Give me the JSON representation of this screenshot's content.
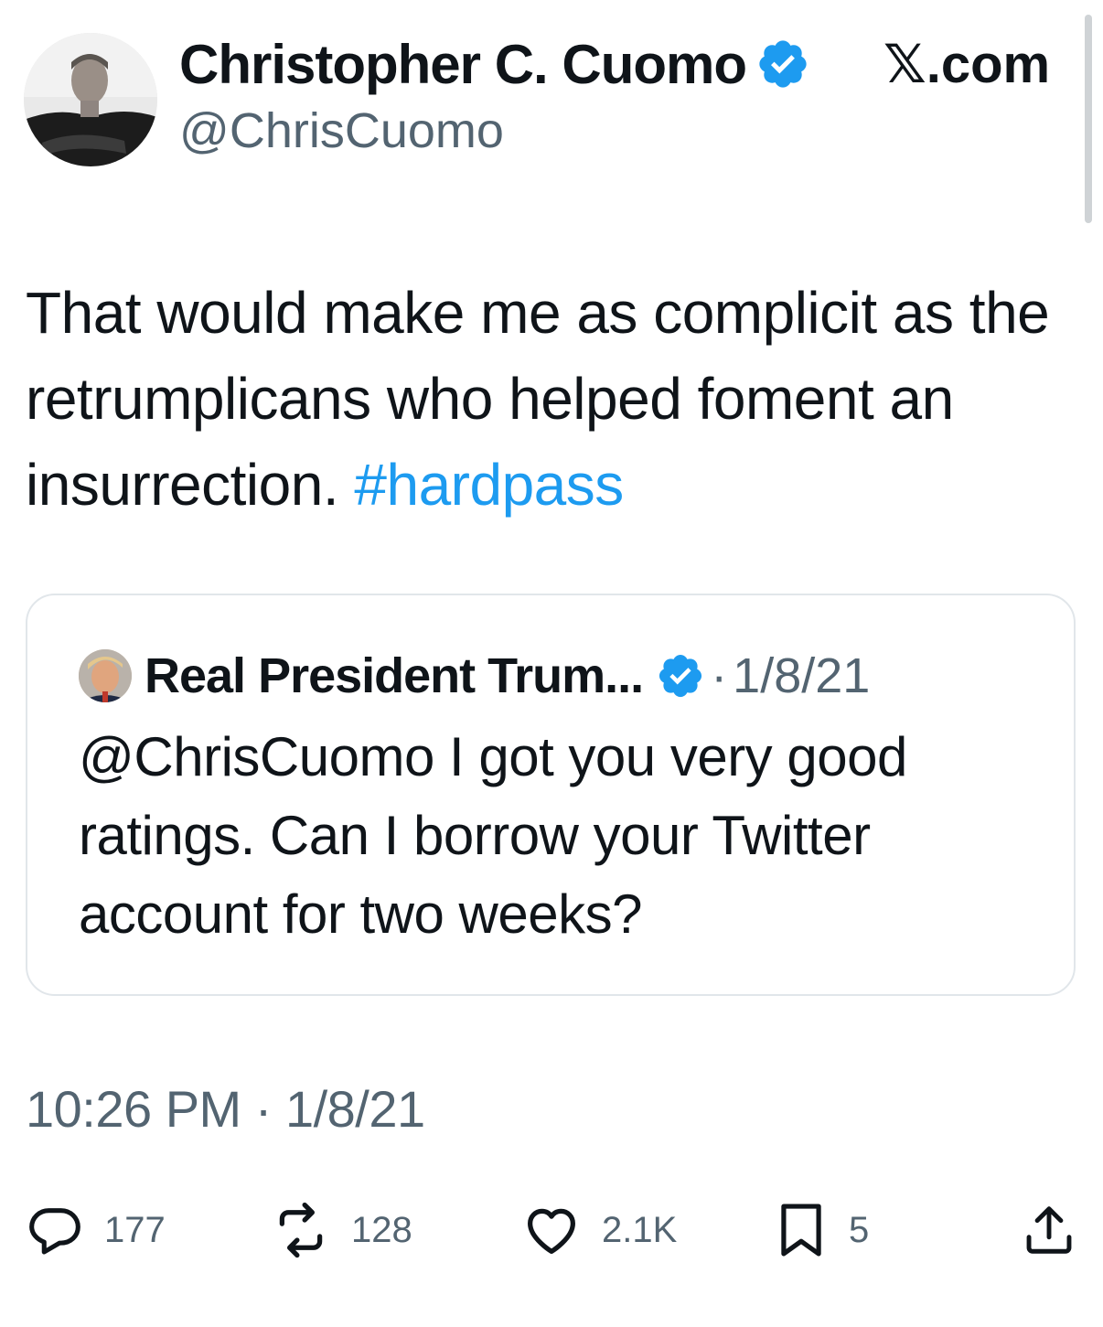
{
  "tweet": {
    "author": {
      "display_name": "Christopher C. Cuomo",
      "handle": "@ChrisCuomo",
      "verified": true
    },
    "brand": "𝕏.com",
    "text": "That would make me as complicit as the retrumplicans who helped foment an insurrection. ",
    "hashtag": "#hardpass",
    "timestamp": "10:26 PM · 1/8/21"
  },
  "quoted_tweet": {
    "author_name": "Real President Trum...",
    "verified": true,
    "separator": "·",
    "date": "1/8/21",
    "text": "@ChrisCuomo I got you very good ratings. Can I borrow your Twitter account for two weeks?"
  },
  "actions": {
    "replies": "177",
    "reposts": "128",
    "likes": "2.1K",
    "bookmarks": "5"
  },
  "colors": {
    "accent": "#1d9bf0",
    "text": "#0f1419",
    "secondary": "#536471",
    "border": "#e1e6ea"
  }
}
